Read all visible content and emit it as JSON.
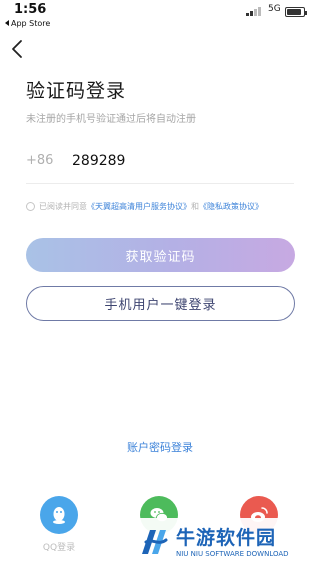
{
  "status_bar": {
    "time": "1:56",
    "back_app": "App Store",
    "network": "5G",
    "battery_level": 0.85
  },
  "header": {
    "back_icon": "chevron-left-icon"
  },
  "main": {
    "title": "验证码登录",
    "subtitle": "未注册的手机号验证通过后将自动注册",
    "country_code": "+86",
    "phone_value": "289289",
    "agreement": {
      "prefix": "已阅读并同意",
      "link1": "《天翼超高清用户服务协议》",
      "and": "和",
      "link2": "《隐私政策协议》"
    },
    "get_code_button": "获取验证码",
    "one_click_login_button": "手机用户一键登录",
    "password_login_link": "账户密码登录"
  },
  "social": {
    "qq_label": "QQ登录",
    "qq_icon": "qq-icon",
    "wechat_icon": "wechat-icon",
    "weibo_icon": "weibo-icon"
  },
  "watermark": {
    "title": "牛游软件园",
    "subtitle": "NIU NIU SOFTWARE DOWNLOAD"
  },
  "colors": {
    "accent_blue": "#3d83d9",
    "qq": "#4aa6ea",
    "wechat": "#4dbb5c",
    "weibo": "#ea5a50"
  }
}
